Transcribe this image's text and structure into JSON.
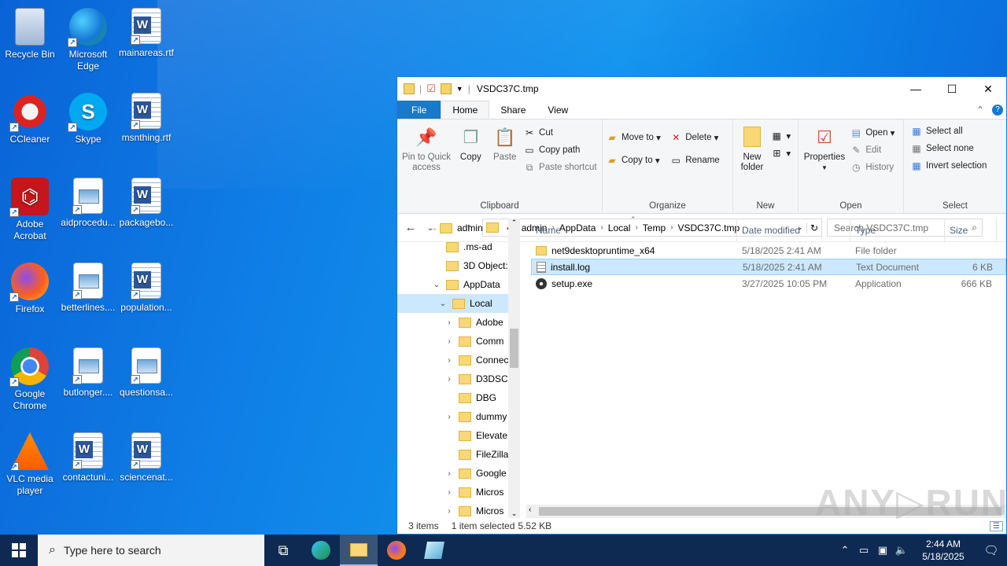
{
  "desktop": {
    "icons": [
      {
        "label": "Recycle Bin",
        "icon": "recycle-bin-icon"
      },
      {
        "label": "Microsoft Edge",
        "icon": "edge-icon"
      },
      {
        "label": "mainareas.rtf",
        "icon": "word-doc-icon"
      },
      {
        "label": "CCleaner",
        "icon": "ccleaner-icon"
      },
      {
        "label": "Skype",
        "icon": "skype-icon"
      },
      {
        "label": "msnthing.rtf",
        "icon": "word-doc-icon"
      },
      {
        "label": "Adobe Acrobat",
        "icon": "acrobat-icon"
      },
      {
        "label": "aidprocedu...",
        "icon": "image-file-icon"
      },
      {
        "label": "packagebo...",
        "icon": "word-doc-icon"
      },
      {
        "label": "Firefox",
        "icon": "firefox-icon"
      },
      {
        "label": "betterlines....",
        "icon": "image-file-icon"
      },
      {
        "label": "population...",
        "icon": "word-doc-icon"
      },
      {
        "label": "Google Chrome",
        "icon": "chrome-icon"
      },
      {
        "label": "butlonger....",
        "icon": "image-file-icon"
      },
      {
        "label": "questionsa...",
        "icon": "image-file-icon"
      },
      {
        "label": "VLC media player",
        "icon": "vlc-icon"
      },
      {
        "label": "contactuni...",
        "icon": "word-doc-icon"
      },
      {
        "label": "sciencenat...",
        "icon": "word-doc-icon"
      }
    ]
  },
  "explorer": {
    "title": "VSDC37C.tmp",
    "tabs": [
      "File",
      "Home",
      "Share",
      "View"
    ],
    "ribbon": {
      "clipboard": {
        "label": "Clipboard",
        "pin": "Pin to Quick access",
        "copy": "Copy",
        "paste": "Paste",
        "cut": "Cut",
        "copy_path": "Copy path",
        "paste_shortcut": "Paste shortcut"
      },
      "organize": {
        "label": "Organize",
        "move_to": "Move to",
        "copy_to": "Copy to",
        "delete": "Delete",
        "rename": "Rename"
      },
      "new": {
        "label": "New",
        "new_folder": "New folder"
      },
      "open": {
        "label": "Open",
        "properties": "Properties",
        "open": "Open",
        "edit": "Edit",
        "history": "History"
      },
      "select": {
        "label": "Select",
        "select_all": "Select all",
        "select_none": "Select none",
        "invert": "Invert selection"
      }
    },
    "address": {
      "prefix": "«",
      "segments": [
        "admin",
        "AppData",
        "Local",
        "Temp",
        "VSDC37C.tmp"
      ]
    },
    "search_placeholder": "Search VSDC37C.tmp",
    "tree": [
      {
        "label": "admin",
        "chev": "v",
        "indent": 0
      },
      {
        "label": ".ms-ad",
        "chev": "",
        "indent": 1
      },
      {
        "label": "3D Object:",
        "chev": "",
        "indent": 1
      },
      {
        "label": "AppData",
        "chev": "v",
        "indent": 1
      },
      {
        "label": "Local",
        "chev": "v",
        "indent": 2,
        "selected": true
      },
      {
        "label": "Adobe",
        "chev": ">",
        "indent": 3
      },
      {
        "label": "Comm",
        "chev": ">",
        "indent": 3
      },
      {
        "label": "Connec",
        "chev": ">",
        "indent": 3
      },
      {
        "label": "D3DSC:",
        "chev": ">",
        "indent": 3
      },
      {
        "label": "DBG",
        "chev": "",
        "indent": 3
      },
      {
        "label": "dummy",
        "chev": ">",
        "indent": 3
      },
      {
        "label": "Elevate",
        "chev": "",
        "indent": 3
      },
      {
        "label": "FileZilla",
        "chev": "",
        "indent": 3
      },
      {
        "label": "Google",
        "chev": ">",
        "indent": 3
      },
      {
        "label": "Micros",
        "chev": ">",
        "indent": 3
      },
      {
        "label": "Micros",
        "chev": ">",
        "indent": 3
      }
    ],
    "columns": {
      "name": "Name",
      "date": "Date modified",
      "type": "Type",
      "size": "Size"
    },
    "files": [
      {
        "name": "net9desktopruntime_x64",
        "date": "5/18/2025 2:41 AM",
        "type": "File folder",
        "size": "",
        "icon": "folder-icon"
      },
      {
        "name": "install.log",
        "date": "5/18/2025 2:41 AM",
        "type": "Text Document",
        "size": "6 KB",
        "icon": "text-file-icon",
        "selected": true
      },
      {
        "name": "setup.exe",
        "date": "3/27/2025 10:05 PM",
        "type": "Application",
        "size": "666 KB",
        "icon": "setup-exe-icon"
      }
    ],
    "status": {
      "items": "3 items",
      "selected": "1 item selected",
      "size": "5.52 KB"
    }
  },
  "watermark": "ANY▷RUN",
  "taskbar": {
    "search_placeholder": "Type here to search",
    "time": "2:44 AM",
    "date": "5/18/2025"
  },
  "colors": {
    "accent": "#1979ca",
    "selection": "#cce8ff",
    "taskbar": "#0f2a52"
  }
}
